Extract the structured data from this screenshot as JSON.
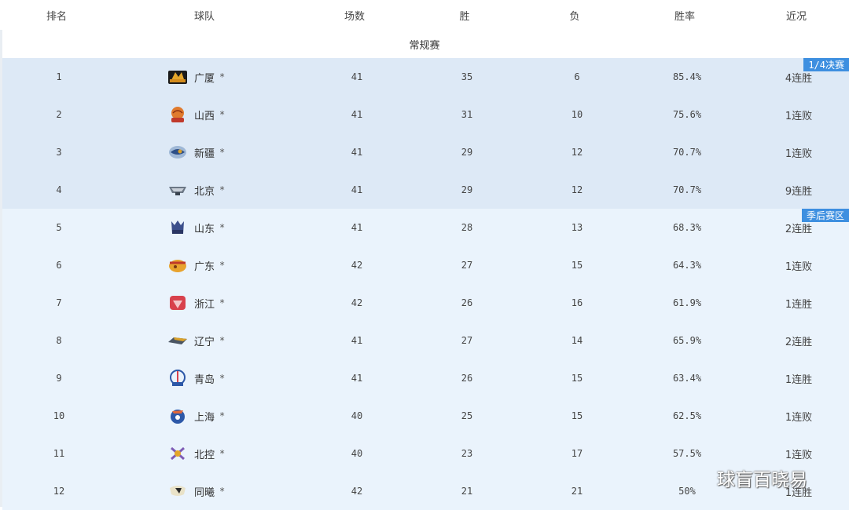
{
  "columns": {
    "rank": "排名",
    "team": "球队",
    "games": "场数",
    "wins": "胜",
    "losses": "负",
    "win_pct": "胜率",
    "streak": "近况"
  },
  "section_title": "常规赛",
  "zones": {
    "playoff": "1/4决赛",
    "playin": "季后赛区"
  },
  "star_symbol": "*",
  "watermark": "球盲百晓易",
  "colors": {
    "playoff_bg": "#dde9f6",
    "playin_bg": "#eaf3fc",
    "tag_bg": "#3d8fe0"
  },
  "rows": [
    {
      "rank": "1",
      "team": "广厦",
      "games": "41",
      "wins": "35",
      "losses": "6",
      "pct": "85.4%",
      "streak": "4连胜",
      "logo": "guangsha-logo"
    },
    {
      "rank": "2",
      "team": "山西",
      "games": "41",
      "wins": "31",
      "losses": "10",
      "pct": "75.6%",
      "streak": "1连败",
      "logo": "shanxi-logo"
    },
    {
      "rank": "3",
      "team": "新疆",
      "games": "41",
      "wins": "29",
      "losses": "12",
      "pct": "70.7%",
      "streak": "1连败",
      "logo": "xinjiang-logo"
    },
    {
      "rank": "4",
      "team": "北京",
      "games": "41",
      "wins": "29",
      "losses": "12",
      "pct": "70.7%",
      "streak": "9连胜",
      "logo": "beijing-logo"
    },
    {
      "rank": "5",
      "team": "山东",
      "games": "41",
      "wins": "28",
      "losses": "13",
      "pct": "68.3%",
      "streak": "2连胜",
      "logo": "shandong-logo"
    },
    {
      "rank": "6",
      "team": "广东",
      "games": "42",
      "wins": "27",
      "losses": "15",
      "pct": "64.3%",
      "streak": "1连败",
      "logo": "guangdong-logo"
    },
    {
      "rank": "7",
      "team": "浙江",
      "games": "42",
      "wins": "26",
      "losses": "16",
      "pct": "61.9%",
      "streak": "1连胜",
      "logo": "zhejiang-logo"
    },
    {
      "rank": "8",
      "team": "辽宁",
      "games": "41",
      "wins": "27",
      "losses": "14",
      "pct": "65.9%",
      "streak": "2连胜",
      "logo": "liaoning-logo"
    },
    {
      "rank": "9",
      "team": "青岛",
      "games": "41",
      "wins": "26",
      "losses": "15",
      "pct": "63.4%",
      "streak": "1连胜",
      "logo": "qingdao-logo"
    },
    {
      "rank": "10",
      "team": "上海",
      "games": "40",
      "wins": "25",
      "losses": "15",
      "pct": "62.5%",
      "streak": "1连败",
      "logo": "shanghai-logo"
    },
    {
      "rank": "11",
      "team": "北控",
      "games": "40",
      "wins": "23",
      "losses": "17",
      "pct": "57.5%",
      "streak": "1连败",
      "logo": "beikong-logo"
    },
    {
      "rank": "12",
      "team": "同曦",
      "games": "42",
      "wins": "21",
      "losses": "21",
      "pct": "50%",
      "streak": "1连胜",
      "logo": "tongxi-logo"
    }
  ]
}
